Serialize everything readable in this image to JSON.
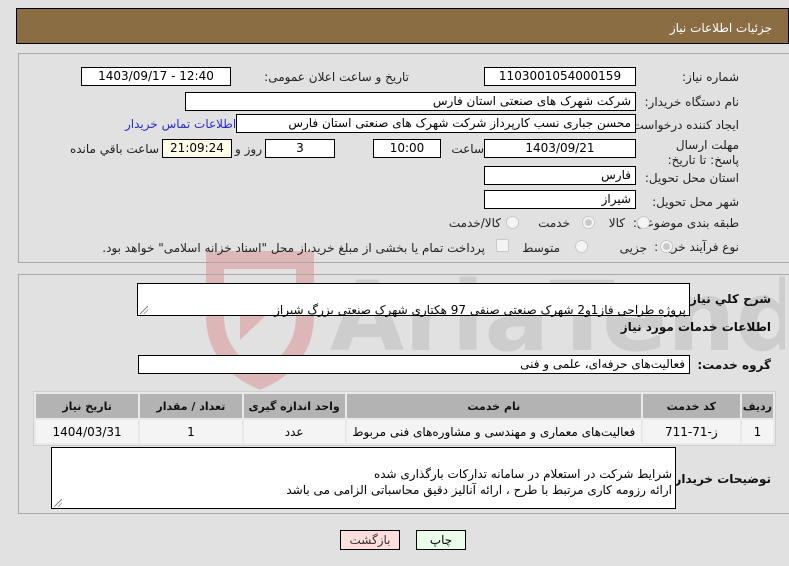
{
  "header": {
    "title": "جزئیات اطلاعات نیاز"
  },
  "fields": {
    "need_number": {
      "label": "شماره نیاز:",
      "value": "1103001054000159"
    },
    "announce_datetime": {
      "label": "تاریخ و ساعت اعلان عمومی:",
      "value": "1403/09/17 - 12:40"
    },
    "buyer_org": {
      "label": "نام دستگاه خریدار:",
      "value": "شرکت شهرک های صنعتی استان فارس"
    },
    "requester": {
      "label": "ایجاد کننده درخواست:",
      "value": "محسن  جباری نسب کارپرداز شرکت شهرک های صنعتی استان فارس"
    },
    "buyer_contact_link": "اطلاعات تماس خریدار",
    "deadline": {
      "label": "مهلت ارسال پاسخ: تا تاریخ:",
      "date": "1403/09/21",
      "time_label": "ساعت",
      "time": "10:00",
      "days": "3",
      "days_label": "روز و",
      "remaining": "21:09:24",
      "remaining_label": "ساعت باقي مانده"
    },
    "delivery_province": {
      "label": "استان محل تحویل:",
      "value": "فارس"
    },
    "delivery_city": {
      "label": "شهر محل تحویل:",
      "value": "شیراز"
    },
    "category": {
      "label": "طبقه بندی موضوعی:",
      "options": [
        {
          "label": "کالا",
          "checked": false
        },
        {
          "label": "خدمت",
          "checked": true
        },
        {
          "label": "کالا/خدمت",
          "checked": false
        }
      ]
    },
    "purchase_type": {
      "label": "نوع فرآیند خرید :",
      "options": [
        {
          "label": "جزیی",
          "checked": true
        },
        {
          "label": "متوسط",
          "checked": false
        }
      ],
      "checkbox_label": "پرداخت تمام یا بخشی از مبلغ خرید،از محل \"اسناد خزانه اسلامی\" خواهد بود.",
      "checkbox_checked": false
    }
  },
  "description": {
    "label": "شرح كلي نياز:",
    "value": "پروژه طراحی فاز1و2 شهرک صنعتی صنفی 97 هکتاری شهرک صنعتی بزرگ شیراز"
  },
  "services_section_title": "اطلاعات خدمات مورد نیاز",
  "service_group": {
    "label": "گروه خدمت:",
    "value": "فعالیت‌های حرفه‌ای، علمی و فنی"
  },
  "table": {
    "columns": [
      "ردیف",
      "کد خدمت",
      "نام خدمت",
      "واحد اندازه گیری",
      "تعداد / مقدار",
      "تاریخ نیاز"
    ],
    "rows": [
      [
        "1",
        "ز-71-711",
        "فعالیت‌های معماری و مهندسی و مشاوره‌های فنی مربوط",
        "عدد",
        "1",
        "1404/03/31"
      ]
    ]
  },
  "buyer_notes": {
    "label": "توضیحات خریدار:",
    "value": "شرایط شرکت در استعلام در سامانه تدارکات بارگذاری شده\nارائه رزومه کاری مرتبط با طرح ، ارائه آنالیز دقیق محاسباتی الزامی می باشد"
  },
  "buttons": {
    "print": "چاپ",
    "back": "بازگشت"
  },
  "colors": {
    "header_bg": "#8b6d43",
    "print_bg": "#eaffea",
    "back_bg": "#ffdede",
    "link": "#2b2bd1"
  },
  "watermark": "AriaTender.net"
}
